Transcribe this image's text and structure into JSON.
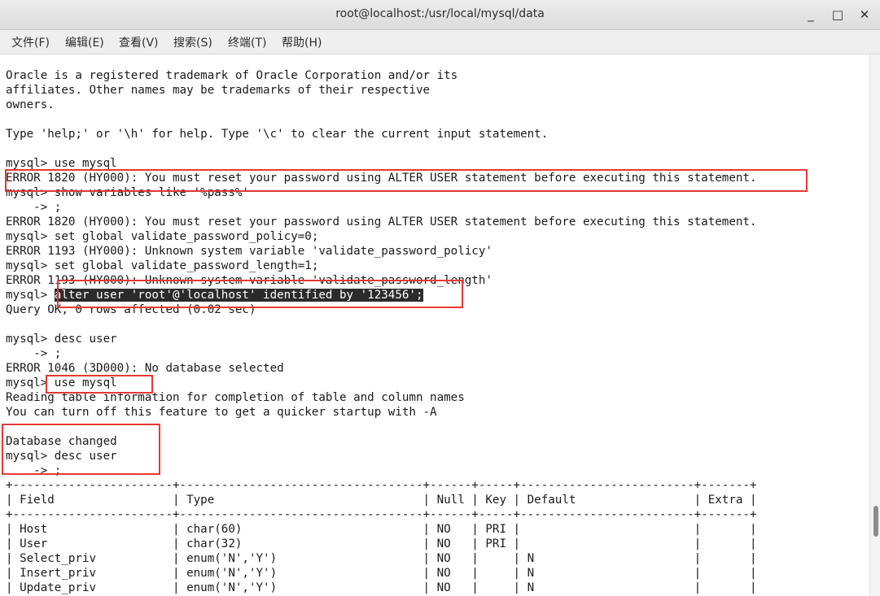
{
  "window": {
    "title": "root@localhost:/usr/local/mysql/data",
    "minimize_glyph": "_",
    "maximize_glyph": "□",
    "close_glyph": "✕"
  },
  "menu": [
    "文件(F)",
    "编辑(E)",
    "查看(V)",
    "搜索(S)",
    "终端(T)",
    "帮助(H)"
  ],
  "terminal": {
    "lines": [
      "Oracle is a registered trademark of Oracle Corporation and/or its",
      "affiliates. Other names may be trademarks of their respective",
      "owners.",
      "",
      "Type 'help;' or '\\h' for help. Type '\\c' to clear the current input statement.",
      "",
      "mysql> use mysql",
      "ERROR 1820 (HY000): You must reset your password using ALTER USER statement before executing this statement.",
      "mysql> show variables like '%pass%'",
      "    -> ;",
      "ERROR 1820 (HY000): You must reset your password using ALTER USER statement before executing this statement.",
      "mysql> set global validate_password_policy=0;",
      "ERROR 1193 (HY000): Unknown system variable 'validate_password_policy'",
      "mysql> set global validate_password_length=1;",
      "ERROR 1193 (HY000): Unknown system variable 'validate_password_length'",
      "mysql> ",
      "Query OK, 0 rows affected (0.02 sec)",
      "",
      "mysql> desc user",
      "    -> ;",
      "ERROR 1046 (3D000): No database selected",
      "mysql> use mysql",
      "Reading table information for completion of table and column names",
      "You can turn off this feature to get a quicker startup with -A",
      "",
      "Database changed",
      "mysql> desc user",
      "    -> ;",
      "+-----------------------+-----------------------------------+------+-----+-------------------------+-------+",
      "| Field                 | Type                              | Null | Key | Default                 | Extra |",
      "+-----------------------+-----------------------------------+------+-----+-------------------------+-------+",
      "| Host                  | char(60)                          | NO   | PRI |                         |       |",
      "| User                  | char(32)                          | NO   | PRI |                         |       |",
      "| Select_priv           | enum('N','Y')                     | NO   |     | N                       |       |",
      "| Insert_priv           | enum('N','Y')                     | NO   |     | N                       |       |",
      "| Update_priv           | enum('N','Y')                     | NO   |     | N                       |       |"
    ],
    "selected_text": "alter user 'root'@'localhost' identified by '123456';"
  },
  "annotations": {
    "color": "#e53935"
  }
}
